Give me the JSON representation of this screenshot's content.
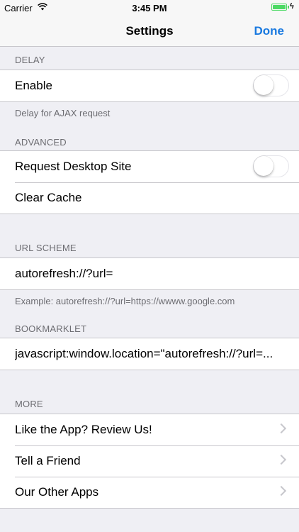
{
  "status": {
    "carrier": "Carrier",
    "time": "3:45 PM",
    "battery_level": 1.0
  },
  "navbar": {
    "title": "Settings",
    "done_label": "Done"
  },
  "sections": {
    "delay": {
      "header": "DELAY",
      "enable_label": "Enable",
      "enable_on": false,
      "footer": "Delay for AJAX request"
    },
    "advanced": {
      "header": "ADVANCED",
      "desktop_label": "Request Desktop Site",
      "desktop_on": false,
      "clear_cache_label": "Clear Cache"
    },
    "url_scheme": {
      "header": "URL SCHEME",
      "value": "autorefresh://?url=",
      "footer": "Example: autorefresh://?url=https://wwww.google.com"
    },
    "bookmarklet": {
      "header": "BOOKMARKLET",
      "value": "javascript:window.location=\"autorefresh://?url=..."
    },
    "more": {
      "header": "MORE",
      "items": [
        {
          "label": "Like the App? Review Us!"
        },
        {
          "label": "Tell a Friend"
        },
        {
          "label": "Our Other Apps"
        }
      ]
    }
  },
  "colors": {
    "accent": "#1a7ae0",
    "background": "#efeff4",
    "secondary_text": "#6d6d72",
    "battery": "#4cd964"
  },
  "icons": {
    "wifi": "wifi-icon",
    "battery": "battery-icon",
    "chevron": "chevron-right-icon"
  }
}
